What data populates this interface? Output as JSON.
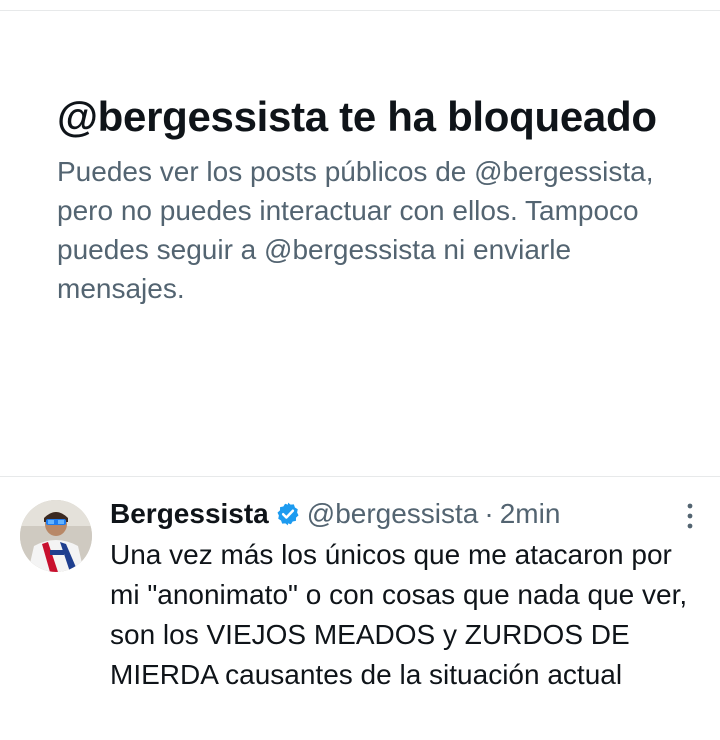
{
  "blocked": {
    "title": "@bergessista te ha bloqueado",
    "description": "Puedes ver los posts públicos de @bergessista, pero no puedes interactuar con ellos. Tampoco puedes seguir a @bergessista ni enviarle mensajes."
  },
  "post": {
    "display_name": "Bergessista",
    "handle": "@bergessista",
    "separator": "·",
    "time": "2min",
    "text": "Una vez más los únicos que me atacaron por mi \"anonimato\" o con cosas que nada que ver, son los VIEJOS MEADOS y ZURDOS DE MIERDA causantes de la situación actual",
    "verified_icon": "verified-badge-icon",
    "more_icon": "more-options-icon"
  },
  "colors": {
    "text_primary": "#0f1419",
    "text_secondary": "#536471",
    "verified_blue": "#1d9bf0",
    "divider": "#e7e9ea"
  }
}
